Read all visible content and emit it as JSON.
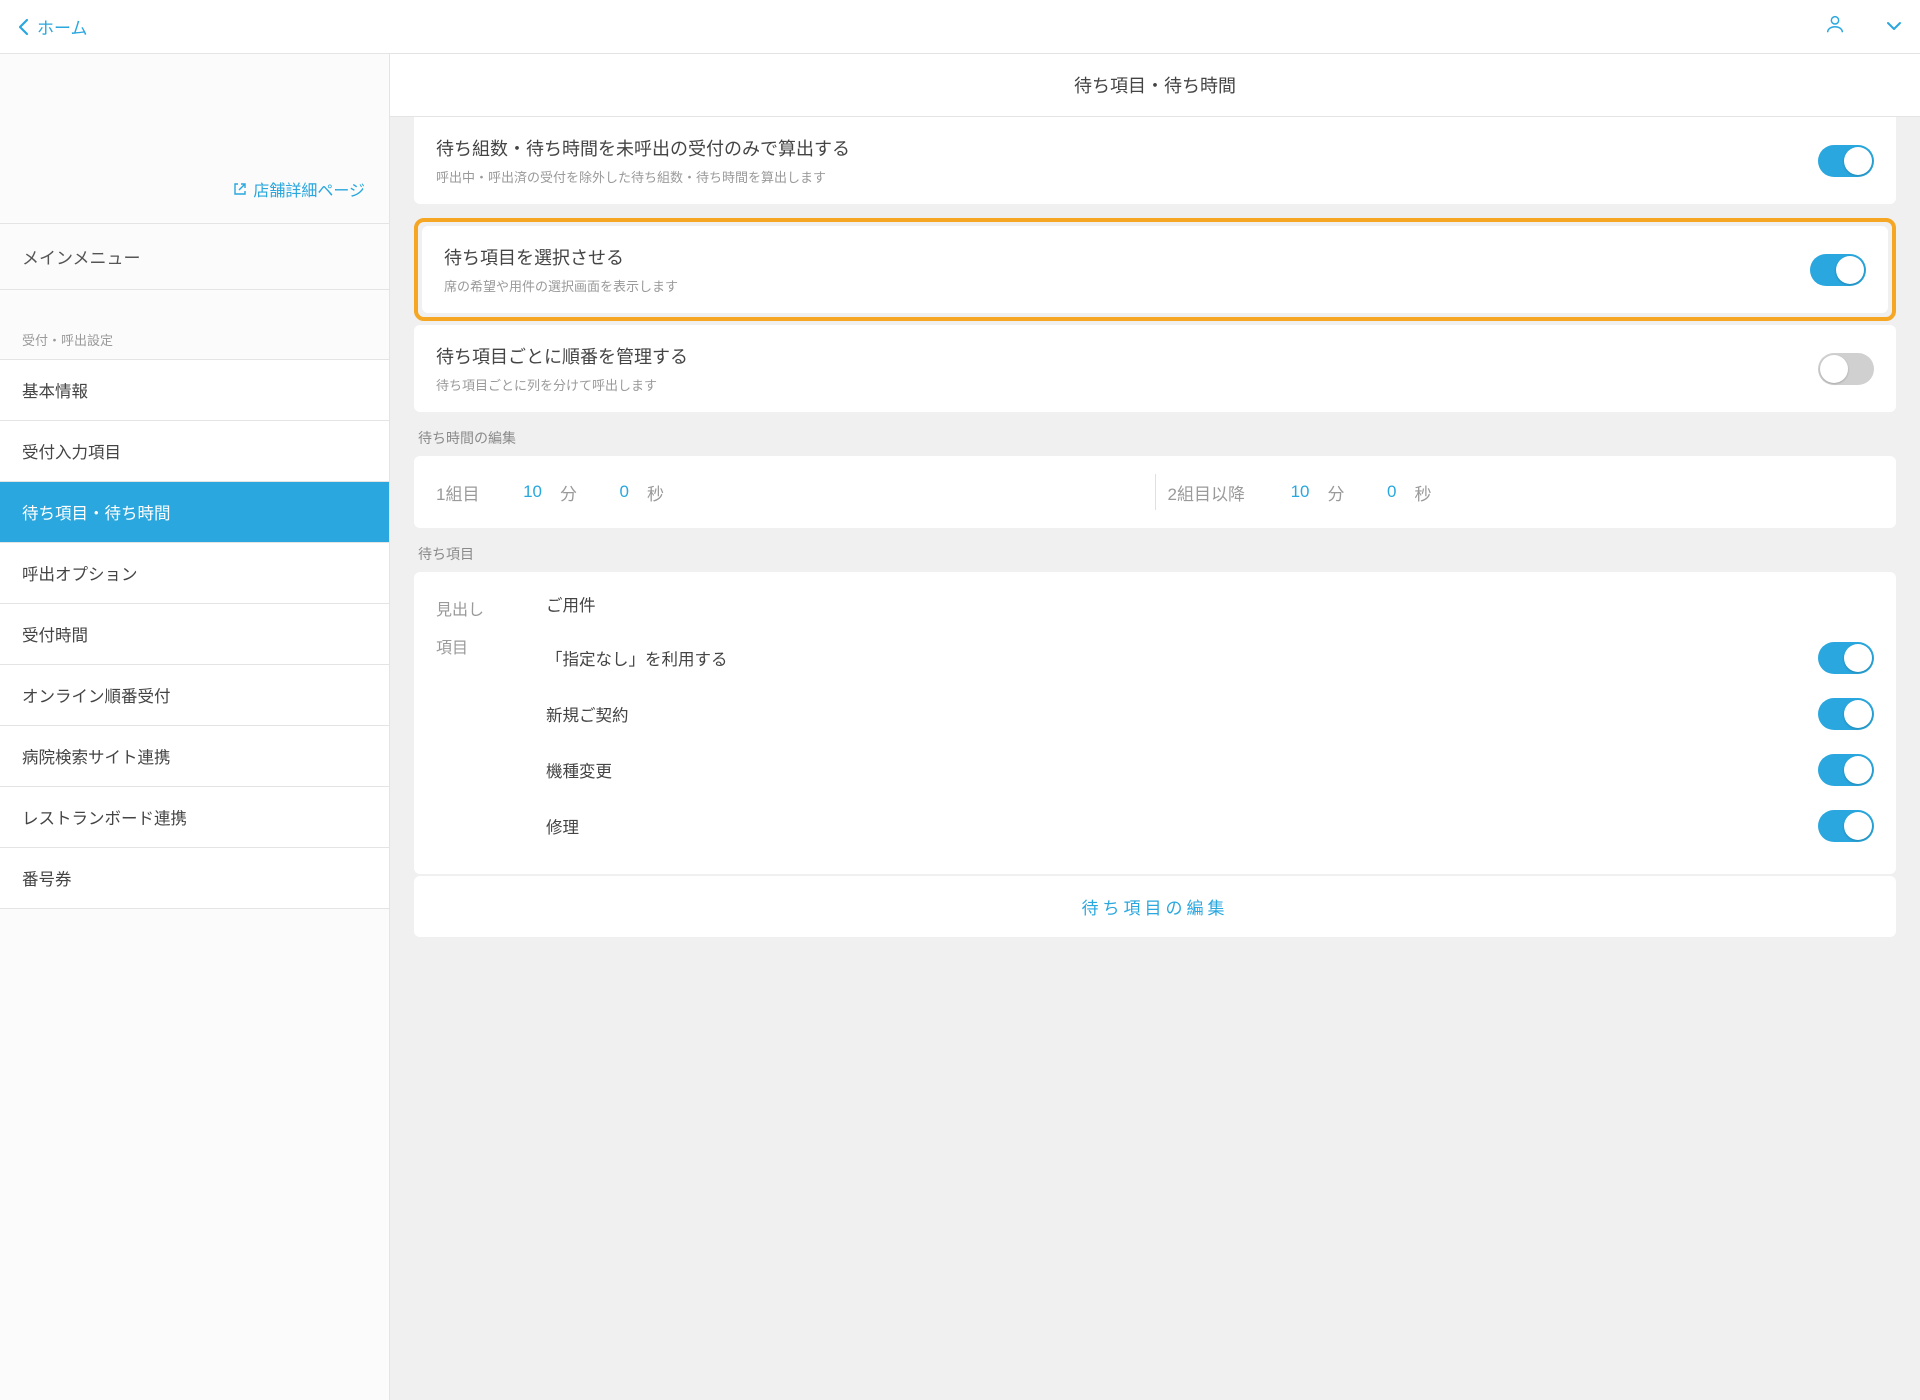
{
  "topbar": {
    "home_label": "ホーム"
  },
  "sidebar": {
    "store_link_label": "店舗詳細ページ",
    "main_menu_label": "メインメニュー",
    "section_label": "受付・呼出設定",
    "items": [
      "基本情報",
      "受付入力項目",
      "待ち項目・待ち時間",
      "呼出オプション",
      "受付時間",
      "オンライン順番受付",
      "病院検索サイト連携",
      "レストランボード連携",
      "番号券"
    ],
    "active_index": 2
  },
  "main": {
    "title": "待ち項目・待ち時間",
    "settings": {
      "only_uncalled": {
        "title": "待ち組数・待ち時間を未呼出の受付のみで算出する",
        "sub": "呼出中・呼出済の受付を除外した待ち組数・待ち時間を算出します",
        "on": true
      },
      "let_select": {
        "title": "待ち項目を選択させる",
        "sub": "席の希望や用件の選択画面を表示します",
        "on": true
      },
      "manage_each": {
        "title": "待ち項目ごとに順番を管理する",
        "sub": "待ち項目ごとに列を分けて呼出します",
        "on": false
      }
    },
    "wait_time": {
      "group_label": "待ち時間の編集",
      "first": {
        "label": "1組目",
        "min": "10",
        "min_unit": "分",
        "sec": "0",
        "sec_unit": "秒"
      },
      "rest": {
        "label": "2組目以降",
        "min": "10",
        "min_unit": "分",
        "sec": "0",
        "sec_unit": "秒"
      }
    },
    "wait_items": {
      "group_label": "待ち項目",
      "heading_key": "見出し",
      "heading_value": "ご用件",
      "items_key": "項目",
      "options": [
        {
          "label": "「指定なし」を利用する",
          "on": true
        },
        {
          "label": "新規ご契約",
          "on": true
        },
        {
          "label": "機種変更",
          "on": true
        },
        {
          "label": "修理",
          "on": true
        }
      ],
      "edit_label": "待ち項目の編集"
    }
  }
}
